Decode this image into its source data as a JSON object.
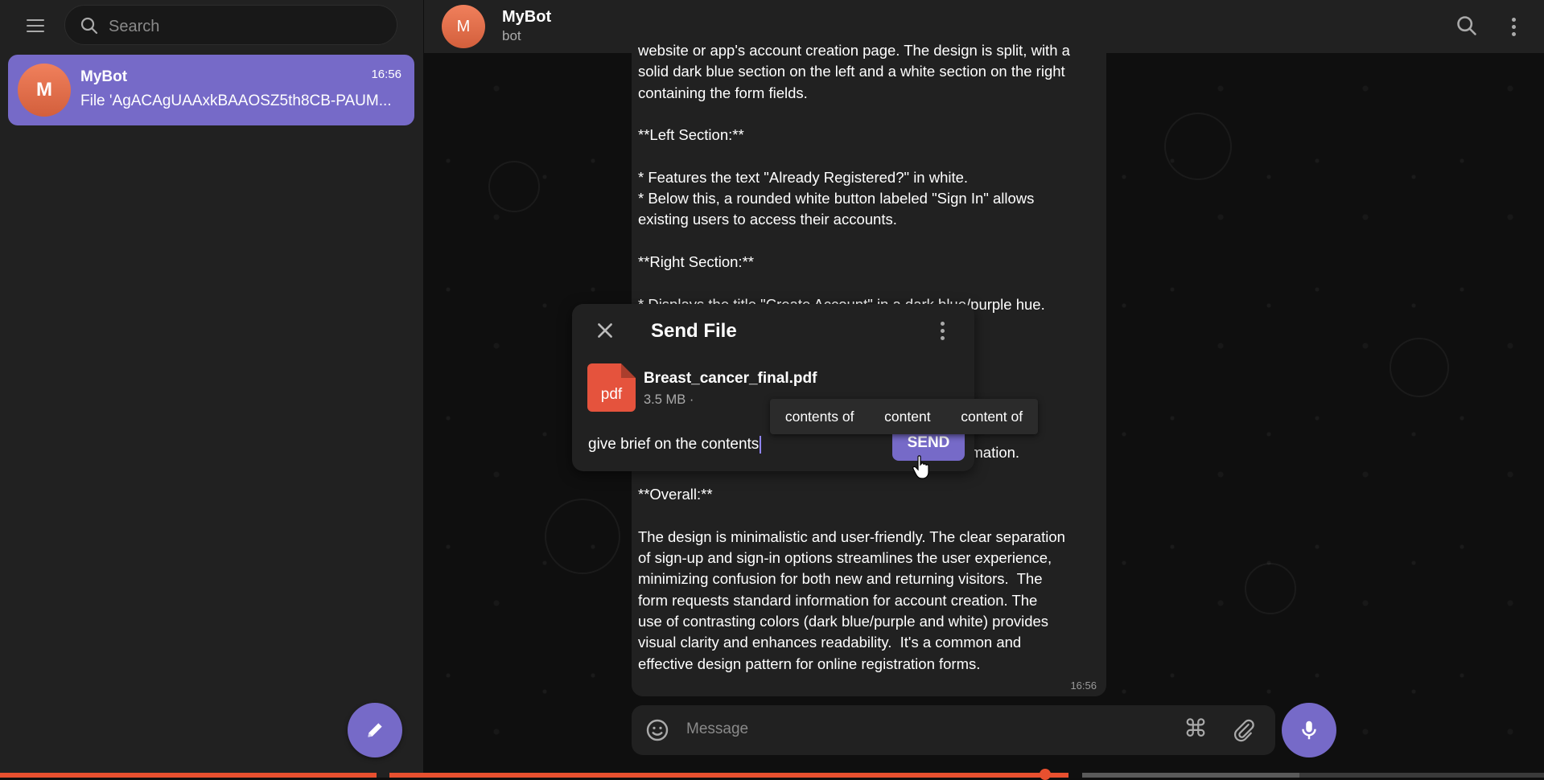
{
  "sidebar": {
    "search_placeholder": "Search",
    "chats": [
      {
        "avatar_letter": "M",
        "name": "MyBot",
        "time": "16:56",
        "preview": "File 'AgACAgUAAxkBAAOSZ5th8CB-PAUM..."
      }
    ]
  },
  "chat": {
    "avatar_letter": "M",
    "title": "MyBot",
    "status": "bot",
    "message": {
      "text": "website or app's account creation page. The design is split, with a\nsolid dark blue section on the left and a white section on the right\ncontaining the form fields.\n\n**Left Section:**\n\n* Features the text \"Already Registered?\" in white.\n* Below this, a rounded white button labeled \"Sign In\" allows\nexisting users to access their accounts.\n\n**Right Section:**\n\n* Displays the title \"Create Account\" in a dark blue/purple hue.\n* Input fields with light gray backgrounds\n\n\n\n\n* A dark blue/purple button labeled \"Sign Up\"\nenables new users to submit their registration information.\n\n**Overall:**\n\nThe design is minimalistic and user-friendly. The clear separation\nof sign-up and sign-in options streamlines the user experience,\nminimizing confusion for both new and returning visitors.  The\nform requests standard information for account creation. The\nuse of contrasting colors (dark blue/purple and white) provides\nvisual clarity and enhances readability.  It's a common and\neffective design pattern for online registration forms.",
      "time": "16:56"
    },
    "composer_placeholder": "Message",
    "command_glyph": "⌘"
  },
  "dialog": {
    "title": "Send File",
    "file_icon_label": "pdf",
    "file_name": "Breast_cancer_final.pdf",
    "file_size": "3.5 MB ·",
    "caption": "give brief on the contents",
    "send_label": "SEND"
  },
  "suggestions": [
    "contents of",
    "content",
    "content of"
  ],
  "colors": {
    "accent": "#766ac8",
    "sidebar_bg": "#212121",
    "main_bg": "#0f0f0f",
    "avatar": "#e06845",
    "pdf": "#e5533d",
    "progress": "#e8502f"
  },
  "icons": [
    "menu-icon",
    "search-icon",
    "pencil-icon",
    "more-vertical-icon",
    "close-icon",
    "smile-icon",
    "command-icon",
    "paperclip-icon",
    "microphone-icon",
    "pdf-file-icon"
  ]
}
